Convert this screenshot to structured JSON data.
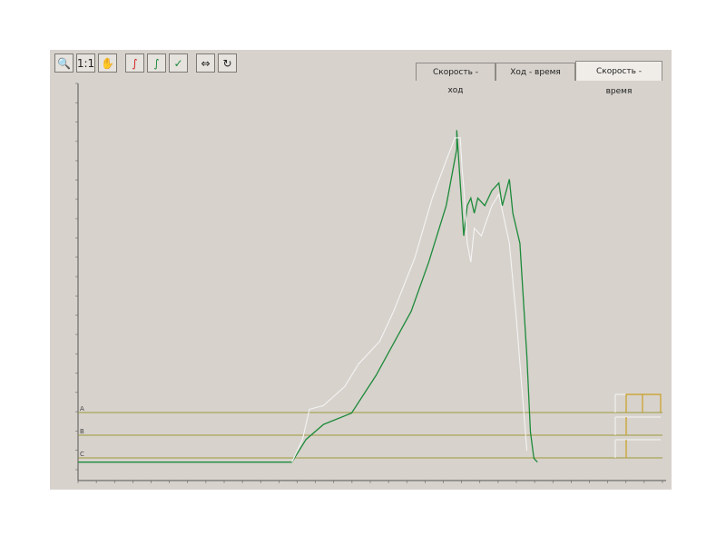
{
  "toolbar": [
    {
      "name": "zoom-tool-icon",
      "glyph": "🔍"
    },
    {
      "name": "scale-1-1-icon",
      "glyph": "1:1"
    },
    {
      "name": "hand-pan-icon",
      "glyph": "✋"
    },
    {
      "name": "curve-red-icon",
      "glyph": "∫"
    },
    {
      "name": "curve-blue-icon",
      "glyph": "∫"
    },
    {
      "name": "curve-check-icon",
      "glyph": "✓"
    },
    {
      "name": "overlay-icon",
      "glyph": "⇔"
    },
    {
      "name": "refresh-icon",
      "glyph": "↻"
    }
  ],
  "tabs": [
    {
      "label": "Скорость - ход",
      "active": false
    },
    {
      "label": "Ход - время",
      "active": false
    },
    {
      "label": "Скорость - время",
      "active": true
    }
  ],
  "levels": [
    "A",
    "B",
    "C"
  ],
  "colors": {
    "background": "#d7d2cc",
    "series_green": "#1d8a3a",
    "series_white": "#f4f4f4",
    "level_lines": "#9c9a3a"
  },
  "chart_data": {
    "type": "line",
    "title": "",
    "xlabel": "",
    "ylabel": "",
    "xlim": [
      0,
      1000
    ],
    "ylim": [
      0,
      100
    ],
    "series": [
      {
        "color": "green",
        "x": [
          0,
          610,
          650,
          700,
          780,
          850,
          950,
          1000,
          1050,
          1080,
          1080,
          1100,
          1110,
          1120,
          1130,
          1140,
          1160,
          1180,
          1200,
          1210,
          1230,
          1240,
          1260,
          1280,
          1290,
          1300,
          1310
        ],
        "y": [
          2,
          2,
          8,
          12,
          15,
          25,
          42,
          55,
          70,
          85,
          90,
          62,
          70,
          72,
          68,
          72,
          70,
          74,
          76,
          70,
          77,
          68,
          60,
          30,
          10,
          3,
          2
        ]
      },
      {
        "color": "white",
        "x": [
          610,
          640,
          660,
          700,
          760,
          800,
          860,
          900,
          960,
          1010,
          1050,
          1075,
          1090,
          1095,
          1100,
          1110,
          1120,
          1130,
          1150,
          1180,
          1200,
          1230,
          1250,
          1280
        ],
        "y": [
          2,
          8,
          16,
          17,
          22,
          28,
          34,
          42,
          56,
          72,
          82,
          88,
          88,
          80,
          75,
          60,
          55,
          64,
          62,
          70,
          73,
          60,
          40,
          5
        ]
      }
    ]
  }
}
